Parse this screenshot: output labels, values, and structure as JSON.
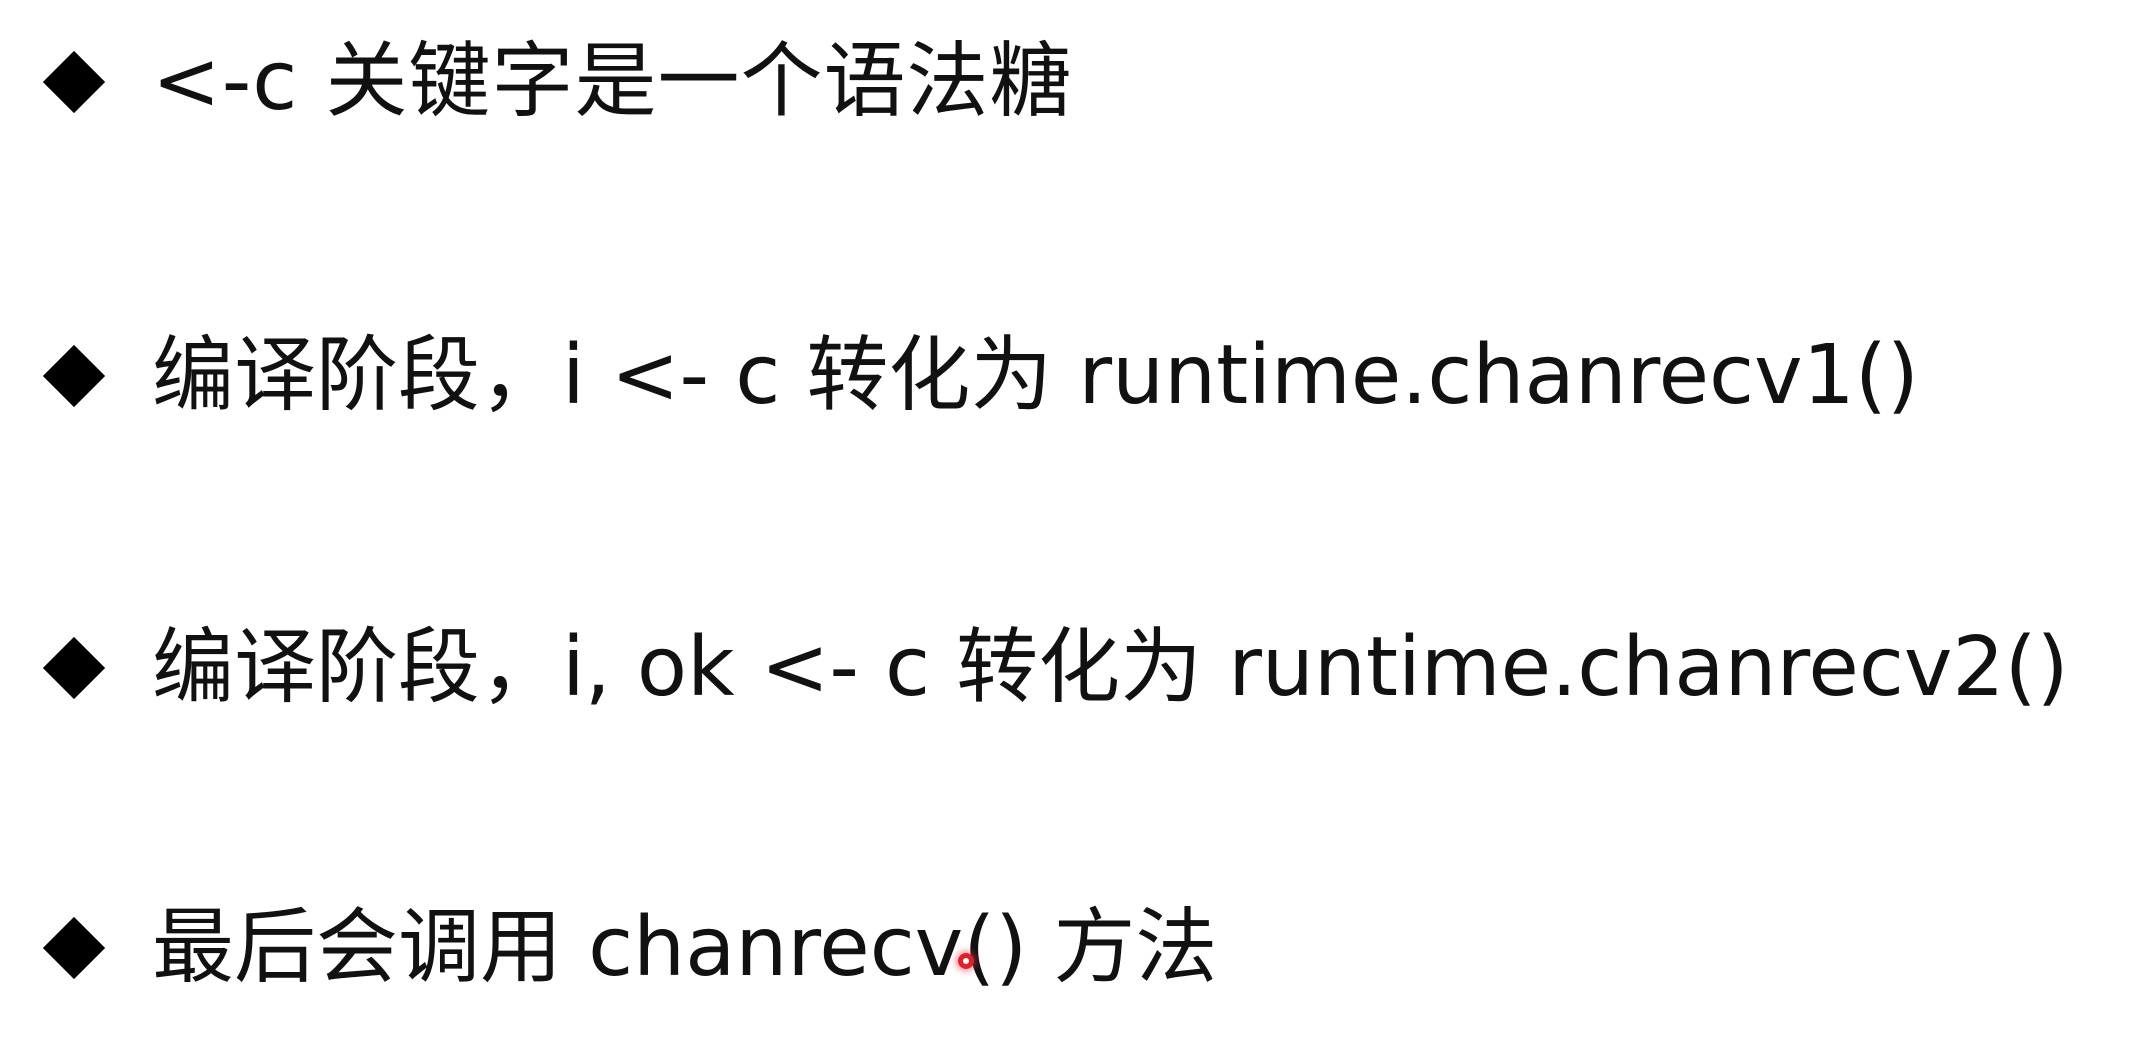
{
  "bullets": [
    {
      "text": "<-c  关键字是一个语法糖"
    },
    {
      "text": "编译阶段，i <- c 转化为 runtime.chanrecv1()"
    },
    {
      "text": "编译阶段，i, ok <- c 转化为 runtime.chanrecv2()"
    },
    {
      "text": "最后会调用 chanrecv() 方法"
    }
  ],
  "bullet_icon": "diamond-bullet-icon",
  "pointer_color": "#e0202a"
}
